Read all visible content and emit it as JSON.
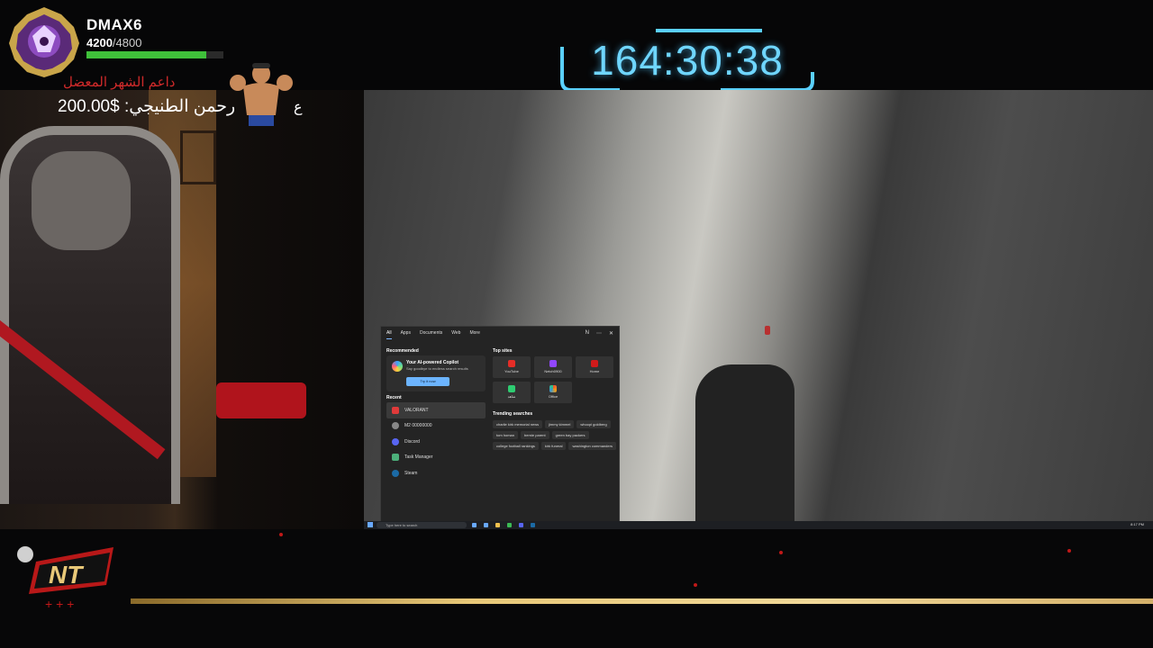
{
  "overlay": {
    "player_name": "DMAX6",
    "xp_current": "4200",
    "xp_max": "/4800",
    "xp_fraction": 0.875,
    "timer": "164:30:38",
    "alert_title": "داعم الشهر  المعضل",
    "alert_amount": "رحمن الطنيجي: $200.00",
    "alert_prefix": "ع"
  },
  "start_menu": {
    "tabs": [
      "All",
      "Apps",
      "Documents",
      "Web",
      "More"
    ],
    "profile_initial": "N",
    "recommended_title": "Recommended",
    "copilot_title": "Your AI-powered Copilot",
    "copilot_sub": "Say goodbye to endless search results",
    "copilot_button": "Try it now",
    "recent_title": "Recent",
    "recent_items": [
      "VALORANT",
      "M2 00000000",
      "Discord",
      "Task Manager",
      "Steam"
    ],
    "top_sites_title": "Top sites",
    "top_sites": [
      "YouTube",
      "Netch0900",
      "Home",
      "شاهد",
      "Office"
    ],
    "trending_title": "Trending searches",
    "trending": [
      "charlie kirk memorial news",
      "jimmy kimmel",
      "whoopi goldberg",
      "tom homan",
      "bernie parent",
      "green bay packers",
      "college football rankings",
      "kirk funeral",
      "washington commanders"
    ]
  },
  "taskbar": {
    "search_placeholder": "Type here to search",
    "time": "8:17 PM"
  },
  "colors": {
    "accent_cyan": "#6fd6ff",
    "xp_green": "#3fc03a",
    "gold": "#e8c878",
    "alert_red": "#d02a2a"
  }
}
